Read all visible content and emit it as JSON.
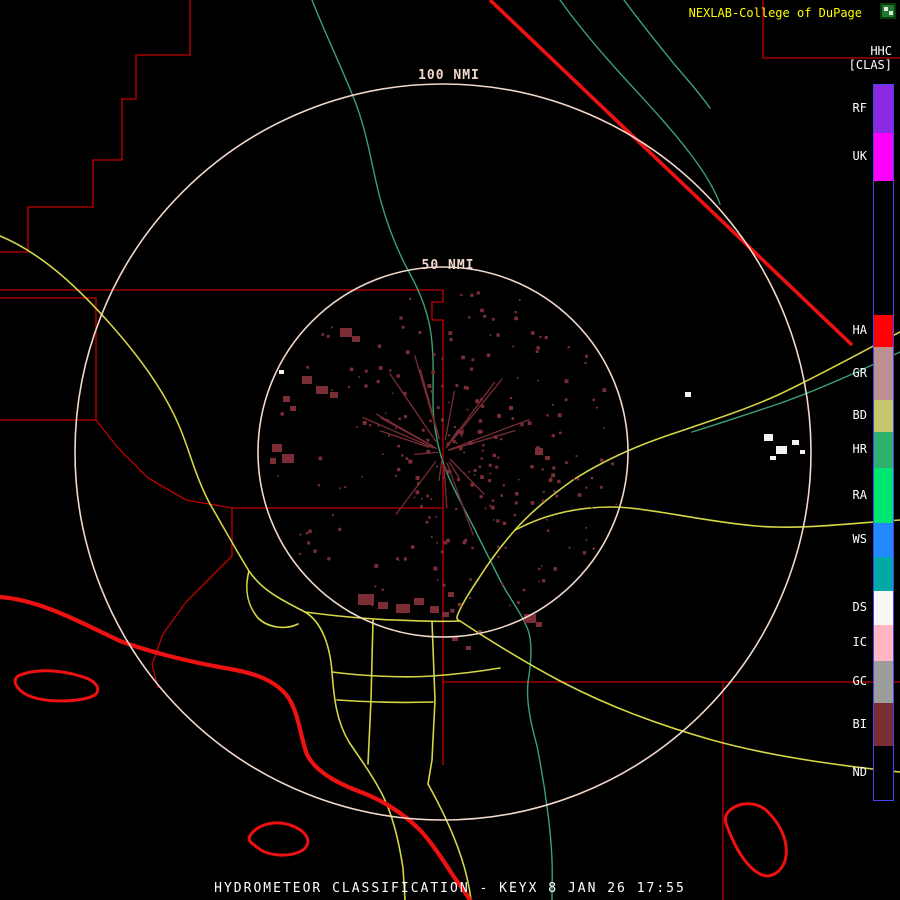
{
  "header": {
    "credit": "NEXLAB-College of DuPage"
  },
  "legend": {
    "product_code": "HHC",
    "product_tag": "[CLAS]",
    "items": [
      {
        "label": "RF",
        "color": "#8a2be2",
        "height": 48
      },
      {
        "label": "UK",
        "color": "#ff00ff",
        "height": 48
      },
      {
        "label": "",
        "color": "#000000",
        "height": 134
      },
      {
        "label": "HA",
        "color": "#ff0000",
        "height": 32
      },
      {
        "label": "GR",
        "color": "#bc9090",
        "height": 53
      },
      {
        "label": "BD",
        "color": "#c6c66a",
        "height": 32
      },
      {
        "label": "HR",
        "color": "#2eb06e",
        "height": 36
      },
      {
        "label": "RA",
        "color": "#00e673",
        "height": 55
      },
      {
        "label": "WS",
        "color": "#2288ff",
        "height": 34
      },
      {
        "label": "",
        "color": "#00a8a8",
        "height": 34
      },
      {
        "label": "DS",
        "color": "#f8f8f8",
        "height": 34
      },
      {
        "label": "IC",
        "color": "#ffb6c1",
        "height": 36
      },
      {
        "label": "GC",
        "color": "#9c9c9c",
        "height": 42
      },
      {
        "label": "BI",
        "color": "#7a2d35",
        "height": 43
      },
      {
        "label": "ND",
        "color": "#000000",
        "height": 54
      }
    ]
  },
  "rings": {
    "inner_label": "50 NMI",
    "outer_label": "100 NMI"
  },
  "footer": {
    "title": "HYDROMETEOR CLASSIFICATION - KEYX 8 JAN 26 17:55"
  },
  "colors": {
    "county": "#c40000",
    "state_coast": "#ee1111",
    "highway": "#d6d645",
    "river": "#3aa076",
    "ring": "#f0d8ca",
    "echo_bio": "#7a2d35",
    "echo_snow": "#f2f2f2",
    "credit_text": "#ffff00",
    "legend_border": "#4444ee"
  }
}
